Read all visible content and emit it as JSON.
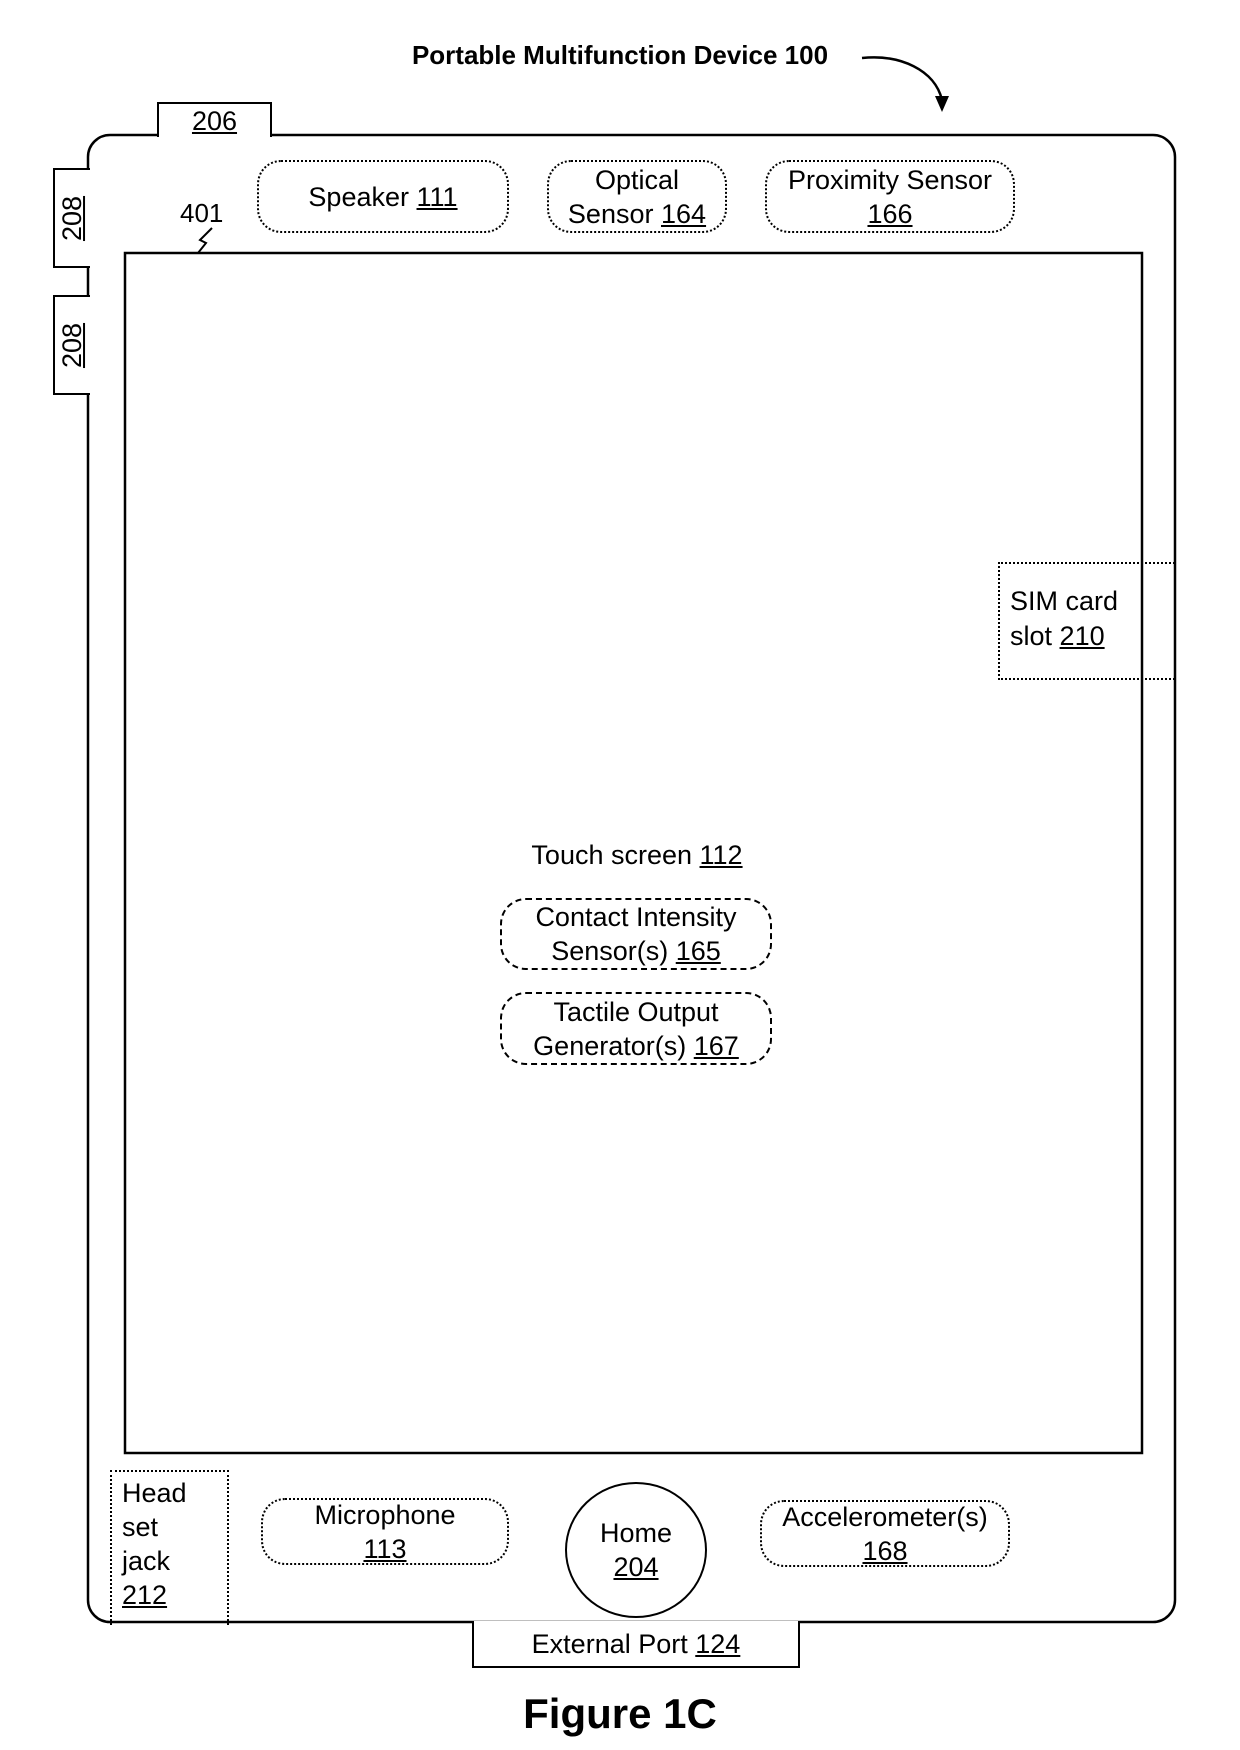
{
  "title": {
    "text": "Portable Multifunction Device",
    "ref": "100"
  },
  "figure_label": "Figure 1C",
  "device": {
    "top_button": {
      "ref": "206"
    },
    "side_buttons": [
      {
        "ref": "208"
      },
      {
        "ref": "208"
      }
    ],
    "screen_ref_leader": "401",
    "top_components": [
      {
        "lines": [
          "Speaker"
        ],
        "ref": "111",
        "inline": true
      },
      {
        "lines": [
          "Optical",
          "Sensor"
        ],
        "ref": "164",
        "inline": true
      },
      {
        "lines": [
          "Proximity Sensor"
        ],
        "ref": "166",
        "inline": false
      }
    ],
    "sim_slot": {
      "line1": "SIM card",
      "line2": "slot",
      "ref": "210"
    },
    "touch_screen": {
      "text": "Touch screen",
      "ref": "112"
    },
    "screen_components": [
      {
        "line1": "Contact Intensity",
        "line2": "Sensor(s)",
        "ref": "165"
      },
      {
        "line1": "Tactile Output",
        "line2": "Generator(s)",
        "ref": "167"
      }
    ],
    "bottom_components": {
      "headset_jack": {
        "lines": [
          "Head",
          "set",
          "jack"
        ],
        "ref": "212"
      },
      "microphone": {
        "line1": "Microphone",
        "ref": "113"
      },
      "home": {
        "line1": "Home",
        "ref": "204"
      },
      "accelerometer": {
        "line1": "Accelerometer(s)",
        "ref": "168"
      }
    },
    "external_port": {
      "text": "External Port",
      "ref": "124"
    }
  }
}
